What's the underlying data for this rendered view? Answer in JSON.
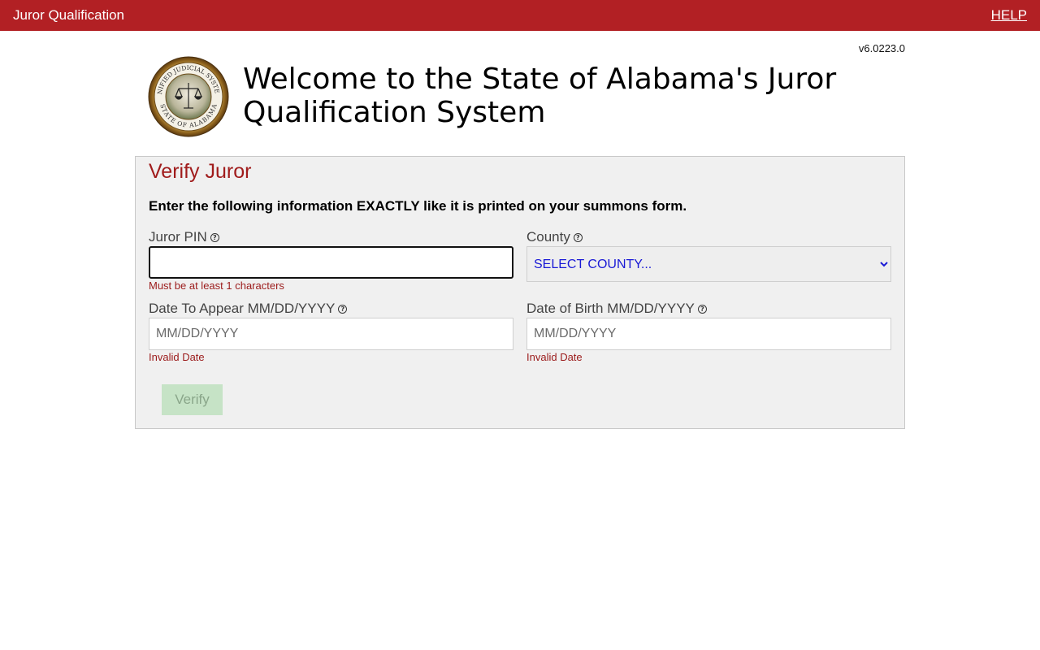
{
  "header": {
    "app_title": "Juror Qualification",
    "help_label": "HELP"
  },
  "version": "v6.0223.0",
  "seal": {
    "ring_top_text": "UNIFIED JUDICIAL SYSTEM",
    "ring_bottom_text": "STATE OF ALABAMA"
  },
  "headline": "Welcome to the State of Alabama's Juror Qualification System",
  "form": {
    "title": "Verify Juror",
    "instruction": "Enter the following information EXACTLY like it is printed on your summons form.",
    "juror_pin": {
      "label": "Juror PIN",
      "value": "",
      "placeholder": "",
      "error": "Must be at least 1 characters"
    },
    "county": {
      "label": "County",
      "selected": "SELECT COUNTY..."
    },
    "date_to_appear": {
      "label": "Date To Appear MM/DD/YYYY",
      "placeholder": "MM/DD/YYYY",
      "error": "Invalid Date"
    },
    "date_of_birth": {
      "label": "Date of Birth MM/DD/YYYY",
      "placeholder": "MM/DD/YYYY",
      "error": "Invalid Date"
    },
    "verify_label": "Verify"
  },
  "colors": {
    "header_bg": "#b22024",
    "title_red": "#a01c1c",
    "error_red": "#9b1a1a",
    "select_text_blue": "#1a1ad6",
    "verify_disabled_bg": "#c6e3c6"
  },
  "icons": {
    "help": "question-circle-icon"
  }
}
